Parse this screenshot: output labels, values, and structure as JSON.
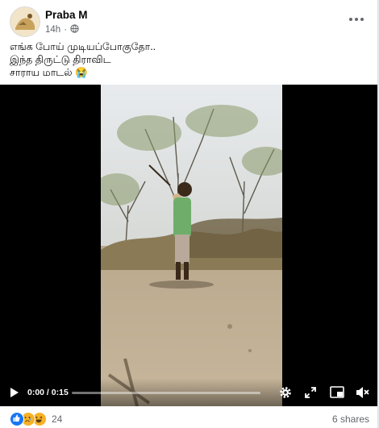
{
  "post": {
    "author": "Praba M",
    "time": "14h",
    "audience_icon": "globe-icon",
    "more_icon": "more-options-icon",
    "text_lines": [
      "எங்க போய் முடியப்போகுதோ..",
      "இந்த திருட்டு திராவிட",
      "சாராய மாடல் 😭"
    ]
  },
  "video": {
    "current_time": "0:00",
    "duration": "0:15",
    "time_display": "0:00 / 0:15",
    "progress": 0,
    "icons": {
      "play": "play-icon",
      "settings": "settings-icon",
      "fullscreen": "fullscreen-icon",
      "pip": "picture-in-picture-icon",
      "volume": "volume-muted-icon"
    }
  },
  "footer": {
    "reaction_icons": [
      "like-icon",
      "sad-icon",
      "haha-icon"
    ],
    "reaction_count": "24",
    "shares": "6 shares"
  },
  "colors": {
    "text_primary": "#050505",
    "text_secondary": "#65676b",
    "like_blue": "#1877f2",
    "reaction_yellow": "#f7b125"
  }
}
